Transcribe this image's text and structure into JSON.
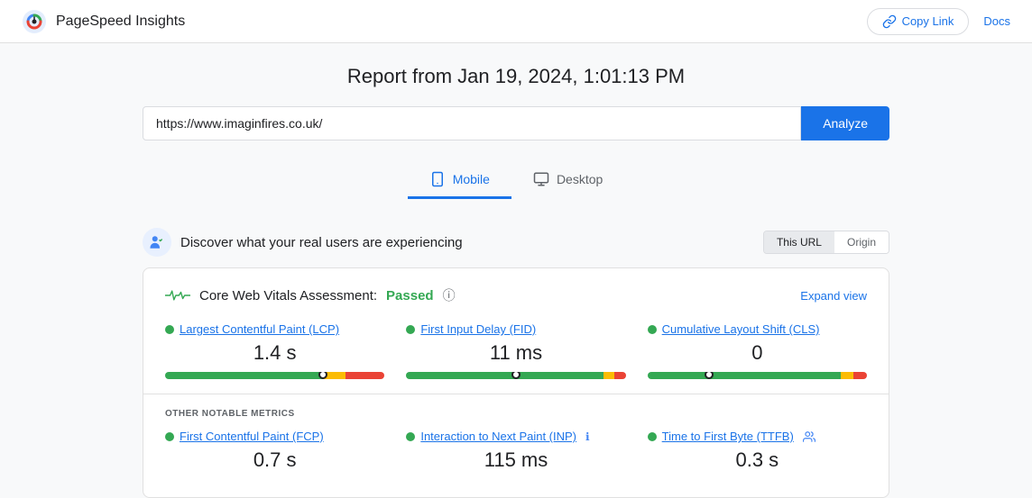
{
  "header": {
    "app_title": "PageSpeed Insights",
    "copy_link_label": "Copy Link",
    "docs_label": "Docs"
  },
  "report": {
    "title": "Report from Jan 19, 2024, 1:01:13 PM",
    "url": "https://www.imaginfires.co.uk/",
    "analyze_label": "Analyze"
  },
  "tabs": [
    {
      "id": "mobile",
      "label": "Mobile",
      "active": true
    },
    {
      "id": "desktop",
      "label": "Desktop",
      "active": false
    }
  ],
  "real_users_section": {
    "title": "Discover what your real users are experiencing",
    "url_toggle": "This URL",
    "origin_toggle": "Origin"
  },
  "cwv": {
    "assessment_label": "Core Web Vitals Assessment:",
    "passed_label": "Passed",
    "expand_label": "Expand view",
    "metrics": [
      {
        "id": "lcp",
        "name": "Largest Contentful Paint (LCP)",
        "value": "1.4 s",
        "good_pct": 72,
        "needs_pct": 10,
        "poor_pct": 18,
        "marker_pct": 72
      },
      {
        "id": "fid",
        "name": "First Input Delay (FID)",
        "value": "11 ms",
        "good_pct": 90,
        "needs_pct": 5,
        "poor_pct": 5,
        "marker_pct": 50
      },
      {
        "id": "cls",
        "name": "Cumulative Layout Shift (CLS)",
        "value": "0",
        "good_pct": 88,
        "needs_pct": 6,
        "poor_pct": 6,
        "marker_pct": 28
      }
    ]
  },
  "other_metrics": {
    "label": "OTHER NOTABLE METRICS",
    "metrics": [
      {
        "id": "fcp",
        "name": "First Contentful Paint (FCP)",
        "value": "0.7 s"
      },
      {
        "id": "inp",
        "name": "Interaction to Next Paint (INP)",
        "value": "115 ms",
        "has_info": true
      },
      {
        "id": "ttfb",
        "name": "Time to First Byte (TTFB)",
        "value": "0.3 s",
        "has_warning": true
      }
    ]
  },
  "colors": {
    "good": "#34a853",
    "needs": "#fbbc04",
    "poor": "#ea4335",
    "blue": "#1a73e8"
  }
}
